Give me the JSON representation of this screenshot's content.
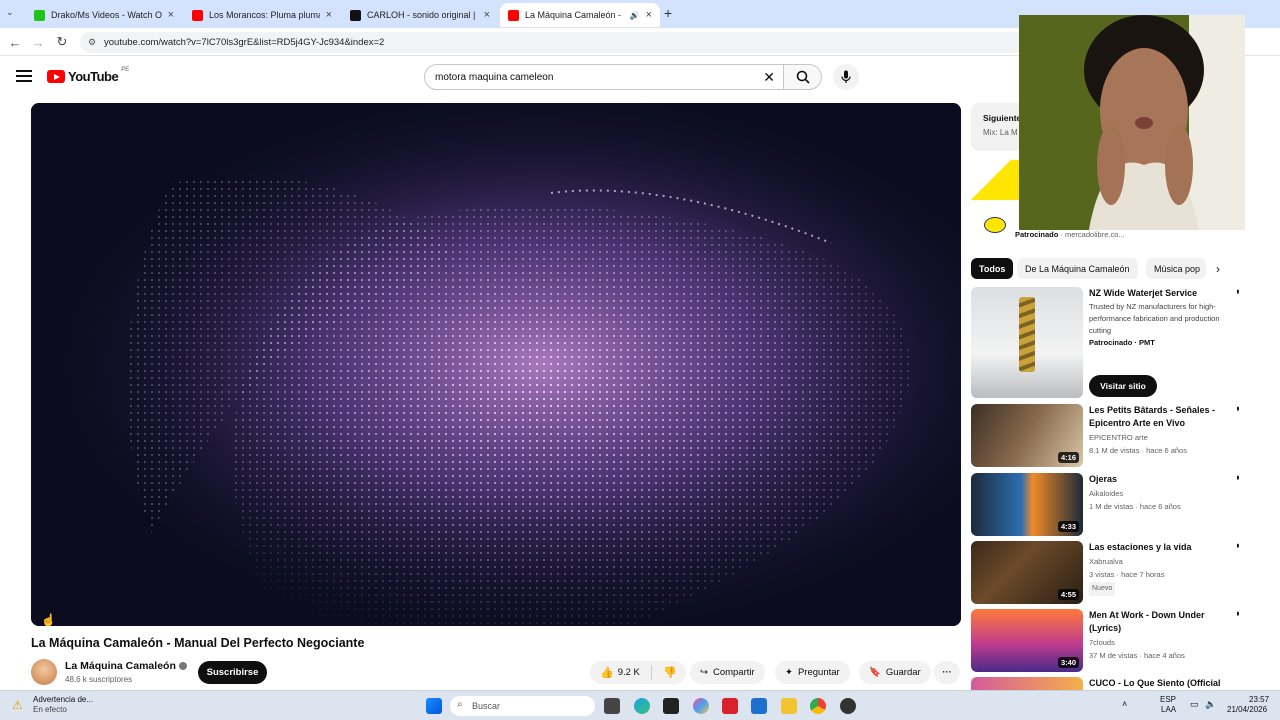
{
  "browser": {
    "tabs": [
      {
        "label": "Drako/Ms Videos - Watch On-",
        "favicon_color": "#1ec41a"
      },
      {
        "label": "Los Morancos: Pluma pluma Ge",
        "favicon_color": "#ff0000"
      },
      {
        "label": "CARLOH - sonido original | Tik",
        "favicon_color": "#111111"
      },
      {
        "label": "La Máquina Camaleón - Ma",
        "favicon_color": "#ff0000"
      }
    ],
    "url": "youtube.com/watch?v=7lC70ls3grE&list=RD5j4GY-Jc934&index=2"
  },
  "header": {
    "logo_text": "YouTube",
    "country_code": "PE",
    "search_value": "motora maquina cameleon"
  },
  "video": {
    "title": "La Máquina Camaleón - Manual Del Perfecto Negociante",
    "channel": "La Máquina Camaleón",
    "subscribers": "48.6 k suscriptores",
    "subscribe_label": "Suscribirse",
    "likes": "9.2 K",
    "share_label": "Compartir",
    "ask_label": "Preguntar",
    "save_label": "Guardar"
  },
  "sidebar": {
    "next_label": "Siguiente",
    "mix_label": "Mix: La M",
    "sponsored_label": "Patrocinado",
    "sponsored_domain": "mercadolibre.co...",
    "chips": [
      "Todos",
      "De La Máquina Camaleón",
      "Música pop"
    ],
    "recommendations": [
      {
        "title": "NZ Wide Waterjet Service",
        "line1": "Trusted by NZ manufacturers for high-performance fabrication and production cutting",
        "line2": "Patrocinado · PMT",
        "duration": "",
        "button": "Visitar sitio"
      },
      {
        "title": "Les Petits Bâtards - Señales - Epicentro Arte en Vivo",
        "line1": "EPICENTRO arte",
        "line2": "8.1 M de vistas · hace 6 años",
        "duration": "4:16"
      },
      {
        "title": "Ojeras",
        "line1": "Aikaloides",
        "line2": "1 M de vistas · hace 6 años",
        "duration": "4:33"
      },
      {
        "title": "Las estaciones y la vida",
        "line1": "Xabrualva",
        "line2": "3 vistas · hace 7 horas",
        "badge": "Nuevo",
        "duration": "4:55"
      },
      {
        "title": "Men At Work - Down Under (Lyrics)",
        "line1": "7clouds",
        "line2": "37 M de vistas · hace 4 años",
        "duration": "3:40"
      },
      {
        "title": "CUCO - Lo Que Siento (Official",
        "line1": "",
        "line2": "",
        "duration": ""
      }
    ]
  },
  "taskbar": {
    "notice_title": "Advertencia de...",
    "notice_sub": "En efecto",
    "search_placeholder": "Buscar",
    "lang": "ESP",
    "lang_sub": "LAA",
    "time": "23:57",
    "date": "21/04/2026"
  }
}
